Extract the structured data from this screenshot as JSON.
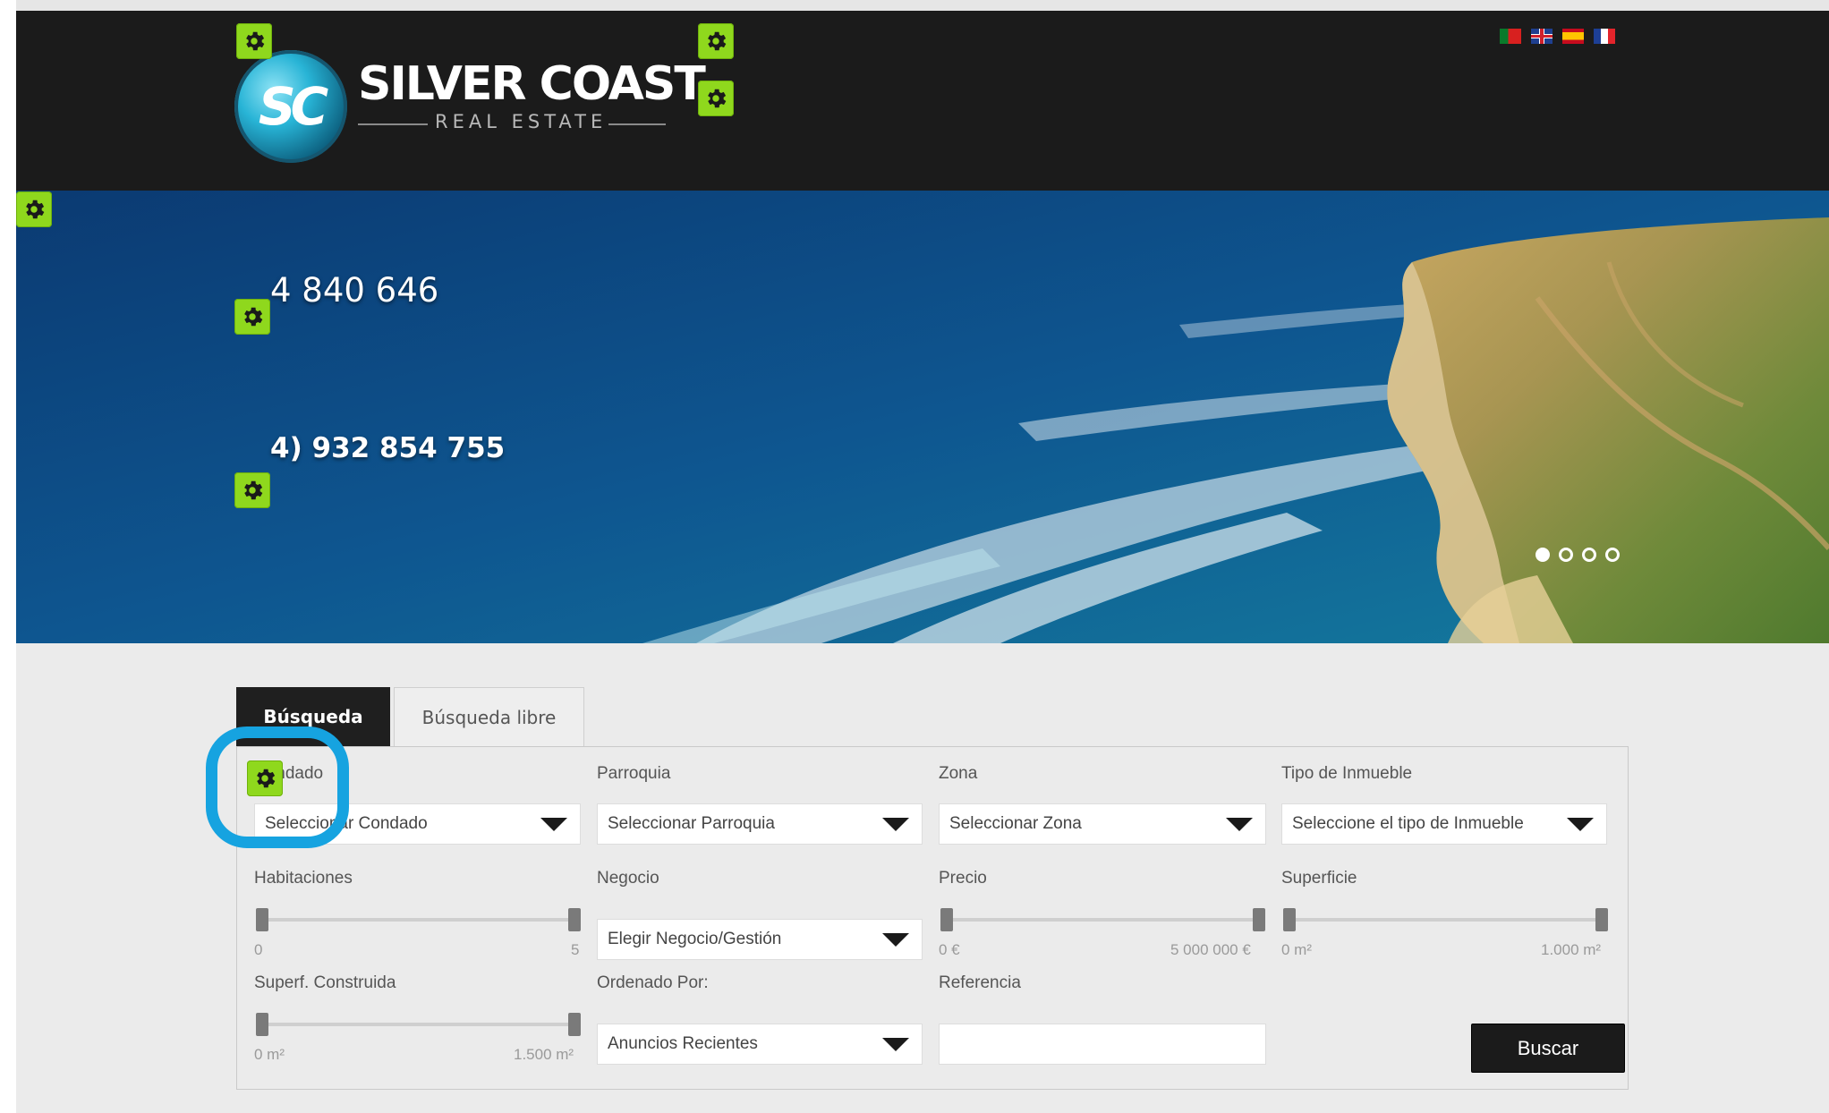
{
  "header": {
    "brand_initials": "SC",
    "brand_name": "SILVER COAST",
    "brand_sub": "REAL ESTATE",
    "languages": [
      "pt",
      "en",
      "es",
      "fr"
    ]
  },
  "hero": {
    "phone_1": "4 840 646",
    "phone_2": "4) 932 854 755",
    "slides_count": 4,
    "active_slide": 1
  },
  "search": {
    "tab_active_label": "Búsqueda",
    "tab_inactive_label": "Búsqueda libre",
    "fields": {
      "condado": {
        "label": "Condado",
        "value": "Seleccionar Condado"
      },
      "parroquia": {
        "label": "Parroquia",
        "value": "Seleccionar Parroquia"
      },
      "zona": {
        "label": "Zona",
        "value": "Seleccionar Zona"
      },
      "tipo": {
        "label": "Tipo de Inmueble",
        "value": "Seleccione el tipo de Inmueble"
      },
      "habitaciones": {
        "label": "Habitaciones",
        "min": "0",
        "max": "5"
      },
      "negocio": {
        "label": "Negocio",
        "value": "Elegir Negocio/Gestión"
      },
      "precio": {
        "label": "Precio",
        "min": "0 €",
        "max": "5 000 000 €"
      },
      "superficie": {
        "label": "Superficie",
        "min": "0 m²",
        "max": "1.000 m²"
      },
      "superf_construida": {
        "label": "Superf. Construida",
        "min": "0 m²",
        "max": "1.500 m²"
      },
      "ordenado": {
        "label": "Ordenado Por:",
        "value": "Anuncios Recientes"
      },
      "referencia": {
        "label": "Referencia",
        "value": ""
      }
    },
    "submit_label": "Buscar"
  },
  "editor": {
    "gear_badge_icon": "gear-icon",
    "badge_color": "#8fd81d",
    "highlight_color": "#16a3e0"
  }
}
